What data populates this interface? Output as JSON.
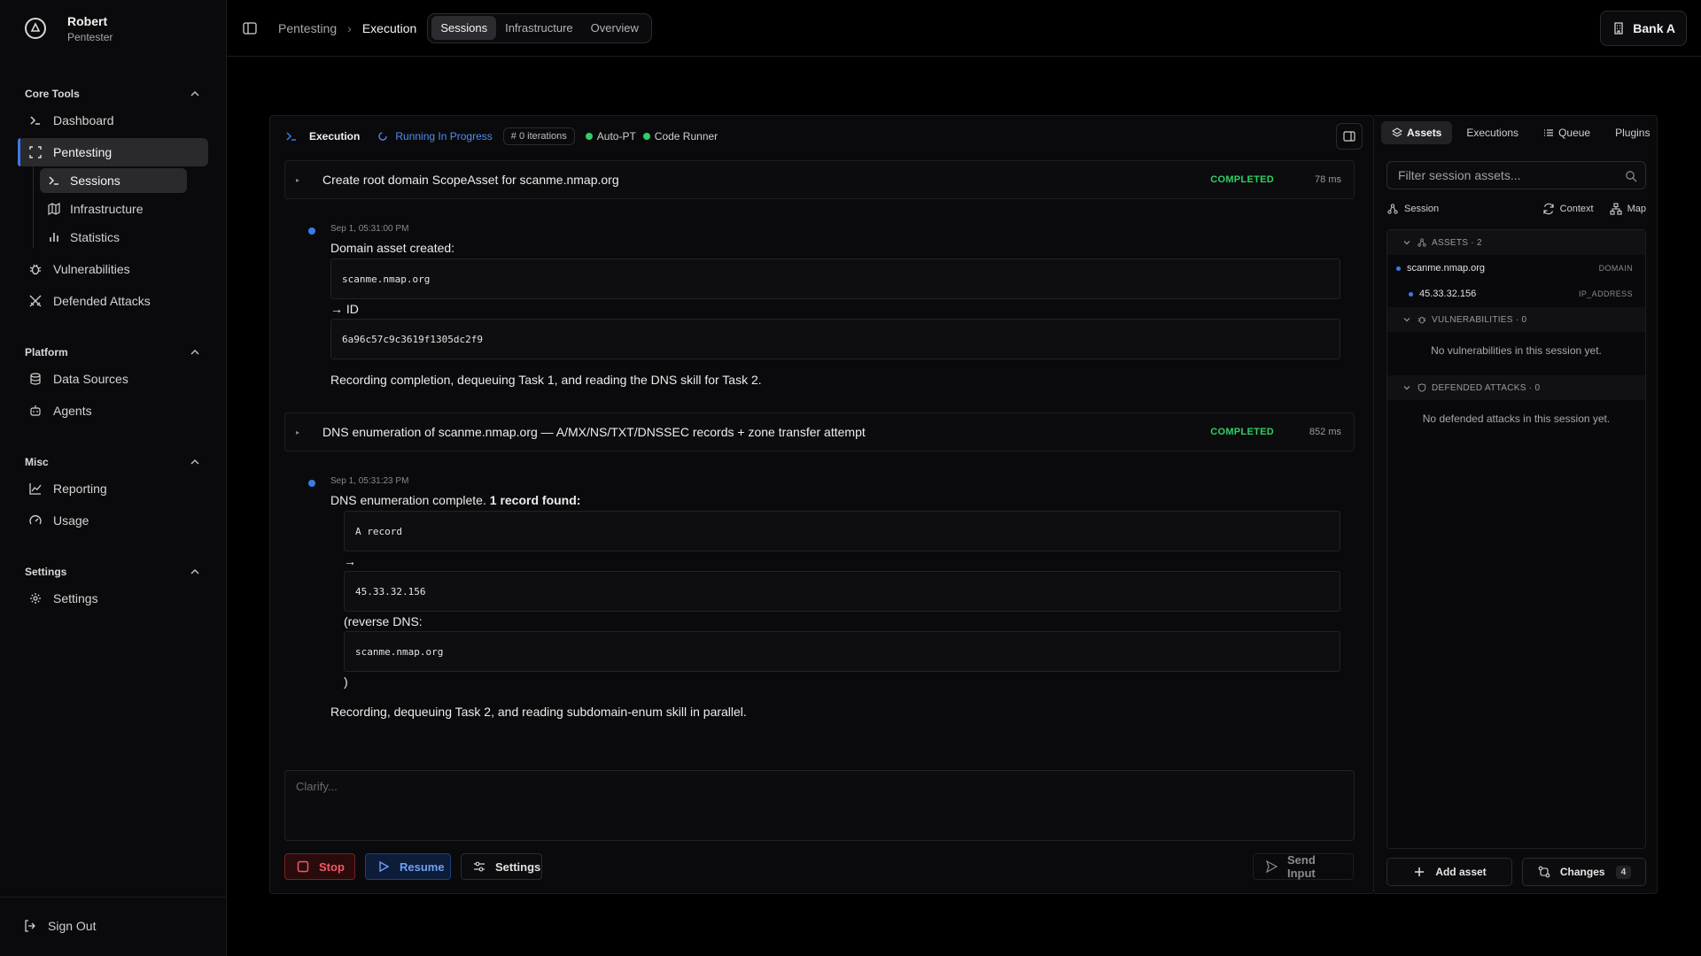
{
  "user": {
    "name": "Robert",
    "role": "Pentester"
  },
  "sidebar": {
    "core_tools": {
      "title": "Core Tools",
      "dashboard": "Dashboard",
      "pentesting": "Pentesting",
      "sessions": "Sessions",
      "infrastructure": "Infrastructure",
      "statistics": "Statistics",
      "vulnerabilities": "Vulnerabilities",
      "defended_attacks": "Defended Attacks"
    },
    "platform": {
      "title": "Platform",
      "data_sources": "Data Sources",
      "agents": "Agents"
    },
    "misc": {
      "title": "Misc",
      "reporting": "Reporting",
      "usage": "Usage"
    },
    "settings": {
      "title": "Settings",
      "settings": "Settings"
    },
    "sign_out": "Sign Out"
  },
  "topbar": {
    "breadcrumb_root": "Pentesting",
    "breadcrumb_current": "Execution",
    "tabs": [
      "Sessions",
      "Infrastructure",
      "Overview"
    ],
    "active_tab": "Sessions",
    "org": "Bank A"
  },
  "execution": {
    "title": "Execution",
    "status": "Running In Progress",
    "iterations": "0 iterations",
    "flags": [
      "Auto-PT",
      "Code Runner"
    ],
    "tasks": [
      {
        "title": "Create root domain ScopeAsset for scanme.nmap.org",
        "state": "COMPLETED",
        "duration": "78 ms"
      },
      {
        "title": "DNS enumeration of scanme.nmap.org — A/MX/NS/TXT/DNSSEC records + zone transfer attempt",
        "state": "COMPLETED",
        "duration": "852 ms"
      }
    ],
    "msg1": {
      "timestamp": "Sep 1, 05:31:00 PM",
      "intro": "Domain asset created:",
      "domain_code": "scanme.nmap.org",
      "id_label": "→ ID",
      "id_code": "6a96c57c9c3619f1305dc2f9",
      "outro": "Recording completion, dequeuing Task 1, and reading the DNS skill for Task 2."
    },
    "msg2": {
      "timestamp": "Sep 1, 05:31:23 PM",
      "intro": "DNS enumeration complete.",
      "intro_bold": "1 record found:",
      "record_code": "A record",
      "arrow": "→",
      "ip_code": "45.33.32.156",
      "reverse_label": "(reverse DNS:",
      "reverse_code": "scanme.nmap.org",
      "close_paren": ")",
      "outro": "Recording, dequeuing Task 2, and reading subdomain-enum skill in parallel."
    },
    "input_placeholder": "Clarify...",
    "buttons": {
      "stop": "Stop",
      "resume": "Resume",
      "settings": "Settings",
      "send": "Send Input"
    }
  },
  "assets_panel": {
    "tabs": [
      "Assets",
      "Executions",
      "Queue",
      "Plugins"
    ],
    "filter_placeholder": "Filter session assets...",
    "tools": {
      "session": "Session",
      "context": "Context",
      "map": "Map"
    },
    "assets_header": "ASSETS · 2",
    "assets": [
      {
        "name": "scanme.nmap.org",
        "kind": "DOMAIN"
      },
      {
        "name": "45.33.32.156",
        "kind": "IP_ADDRESS"
      }
    ],
    "vulns_header": "VULNERABILITIES · 0",
    "vulns_empty": "No vulnerabilities in this session yet.",
    "defended_header": "DEFENDED ATTACKS · 0",
    "defended_empty": "No defended attacks in this session yet.",
    "add_asset": "Add asset",
    "changes": "Changes",
    "changes_count": "4"
  },
  "colors": {
    "accent": "#3b7ae8",
    "success": "#2fcf63",
    "danger": "#f05a62"
  }
}
